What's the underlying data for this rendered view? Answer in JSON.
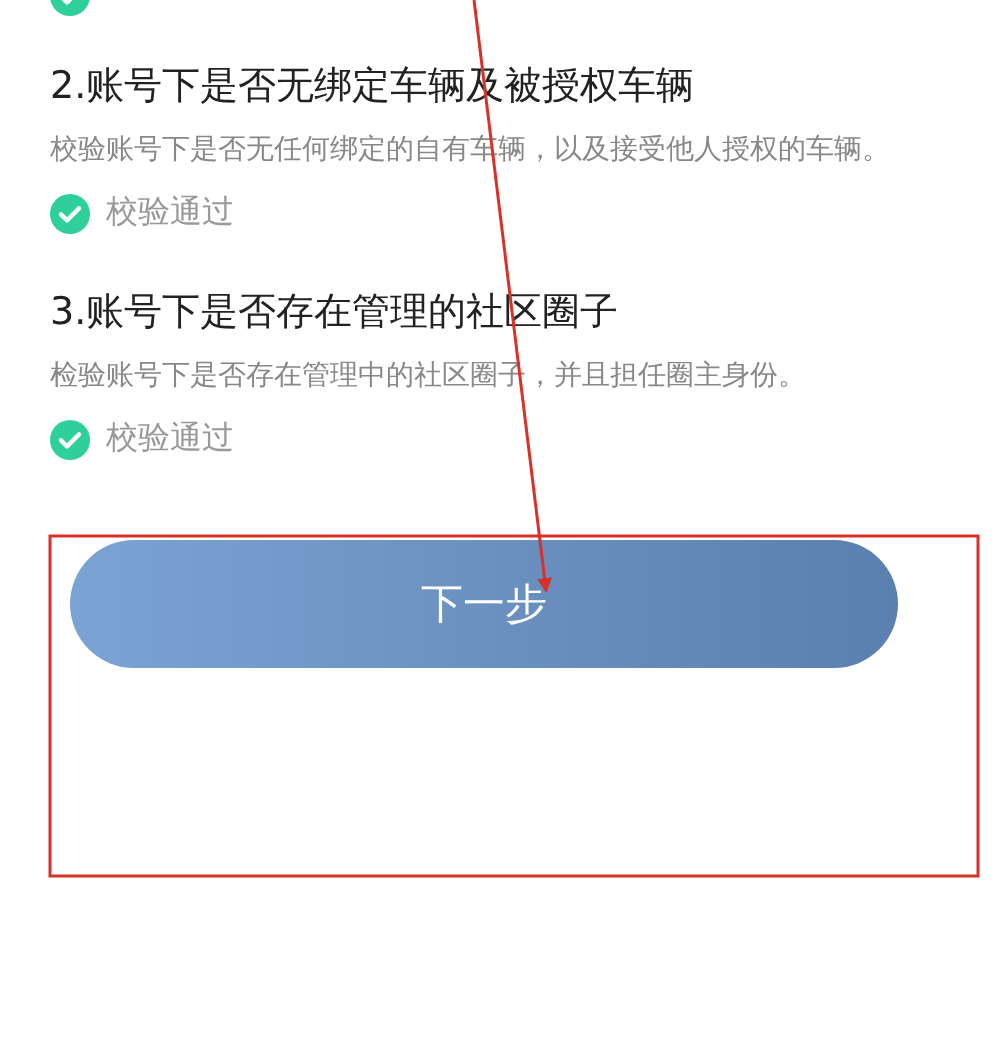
{
  "previous_check": {
    "passed": true
  },
  "checks": [
    {
      "title": "2.账号下是否无绑定车辆及被授权车辆",
      "description": "校验账号下是否无任何绑定的自有车辆，以及接受他人授权的车辆。",
      "status": "校验通过",
      "passed": true
    },
    {
      "title": "3.账号下是否存在管理的社区圈子",
      "description": "检验账号下是否存在管理中的社区圈子，并且担任圈主身份。",
      "status": "校验通过",
      "passed": true
    }
  ],
  "next_button": {
    "label": "下一步"
  },
  "annotations": {
    "arrow": true,
    "highlight_box": true
  }
}
